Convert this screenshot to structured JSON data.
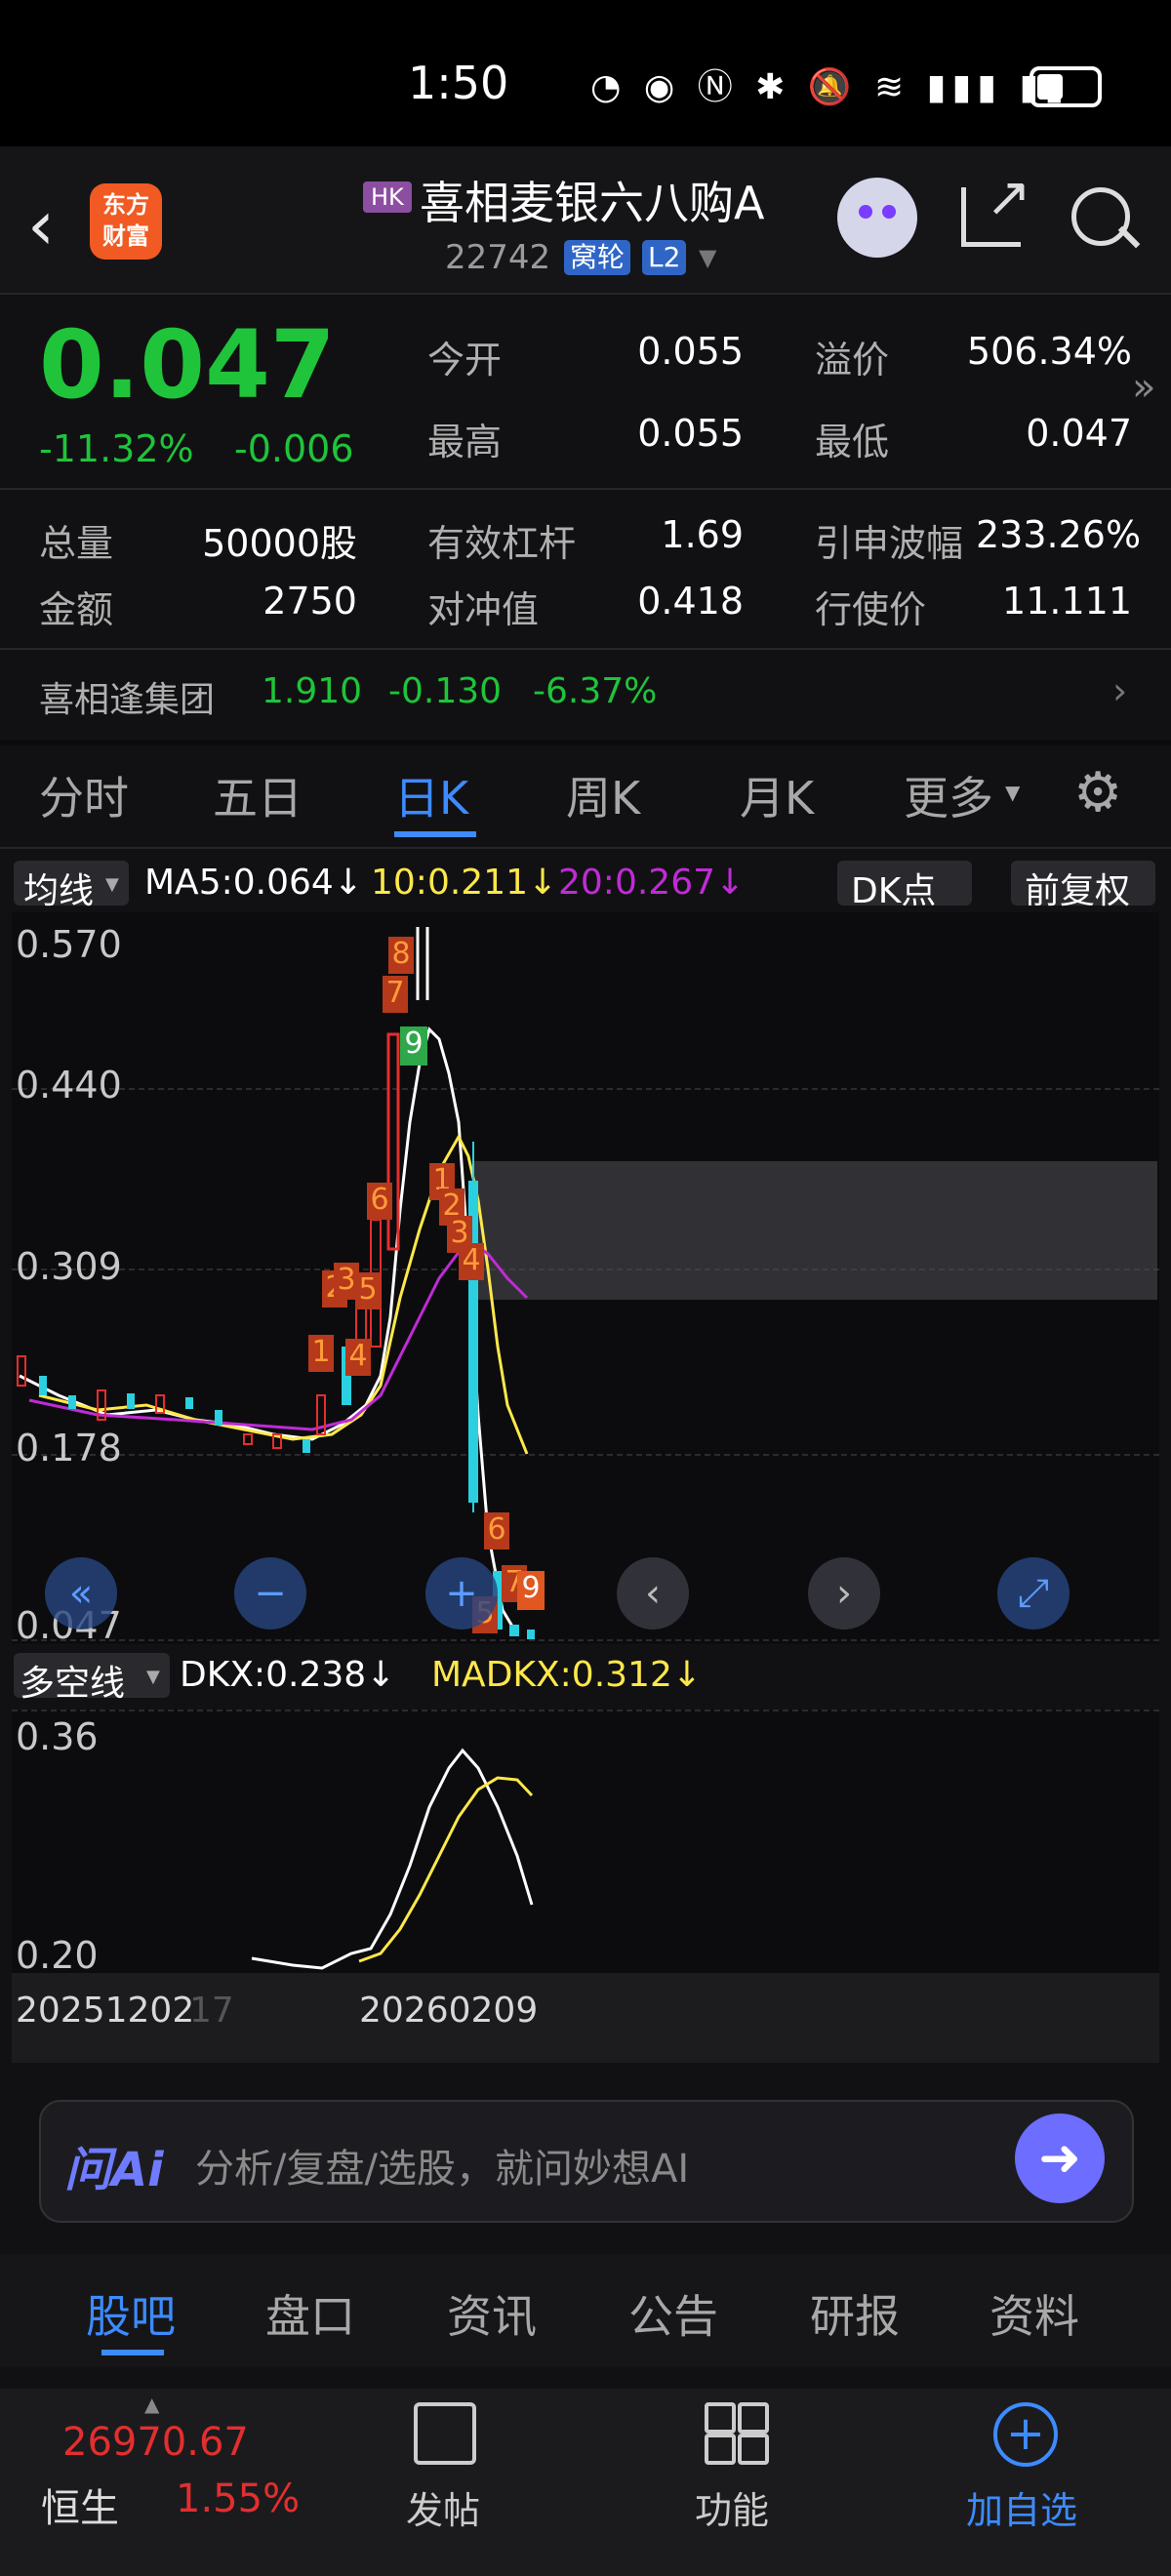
{
  "status": {
    "time": "1:50"
  },
  "header": {
    "logo": "东方\n财富",
    "market_tag": "HK",
    "title": "喜相麦银六八购A",
    "code": "22742",
    "tag1": "窝轮",
    "tag2": "L2"
  },
  "quote": {
    "price": "0.047",
    "change_pct": "-11.32%",
    "change": "-0.006",
    "open_label": "今开",
    "open": "0.055",
    "high_label": "最高",
    "high": "0.055",
    "premium_label": "溢价",
    "premium": "506.34%",
    "low_label": "最低",
    "low": "0.047",
    "volume_label": "总量",
    "volume": "50000股",
    "amount_label": "金额",
    "amount": "2750",
    "leverage_label": "有效杠杆",
    "leverage": "1.69",
    "hedge_label": "对冲值",
    "hedge": "0.418",
    "implied_vol_label": "引申波幅",
    "implied_vol": "233.26%",
    "strike_label": "行使价",
    "strike": "11.111"
  },
  "underlying": {
    "name": "喜相逢集团",
    "price": "1.910",
    "change": "-0.130",
    "pct": "-6.37%"
  },
  "period_tabs": [
    "分时",
    "五日",
    "日K",
    "周K",
    "月K",
    "更多"
  ],
  "active_period": "日K",
  "ma_bar": {
    "selector": "均线",
    "ma5": "MA5:0.064↓",
    "ma10": "10:0.211↓",
    "ma20": "20:0.267↓",
    "dk": "DK点",
    "adjust": "前复权"
  },
  "chart_axis": {
    "y1": "0.570",
    "y2": "0.440",
    "y3": "0.309",
    "y4": "0.178",
    "y5": "0.047"
  },
  "sub_bar": {
    "selector": "多空线",
    "dkx": "DKX:0.238↓",
    "madkx": "MADKX:0.312↓"
  },
  "sub_axis": {
    "top": "0.36",
    "bottom": "0.20"
  },
  "date_axis": {
    "start": "20251202",
    "start_faded": "17",
    "mid": "20260209"
  },
  "seq_marks": [
    "8",
    "7",
    "9",
    "6",
    "1",
    "2",
    "3",
    "4",
    "2",
    "3",
    "5",
    "1",
    "4",
    "6",
    "7",
    "5",
    "9"
  ],
  "ask": {
    "brand": "问Ai",
    "placeholder": "分析/复盘/选股，就问妙想AI"
  },
  "bottom_tabs": [
    "股吧",
    "盘口",
    "资讯",
    "公告",
    "研报",
    "资料"
  ],
  "footer": {
    "index_value": "26970.67",
    "index_name": "恒生",
    "index_pct": "1.55%",
    "post": "发帖",
    "func": "功能",
    "add": "加自选"
  },
  "colors": {
    "up": "#e42e2e",
    "down": "#1fc43a",
    "accent": "#3d8bff",
    "ma10": "#ffe84a",
    "ma20": "#c02bd6"
  }
}
